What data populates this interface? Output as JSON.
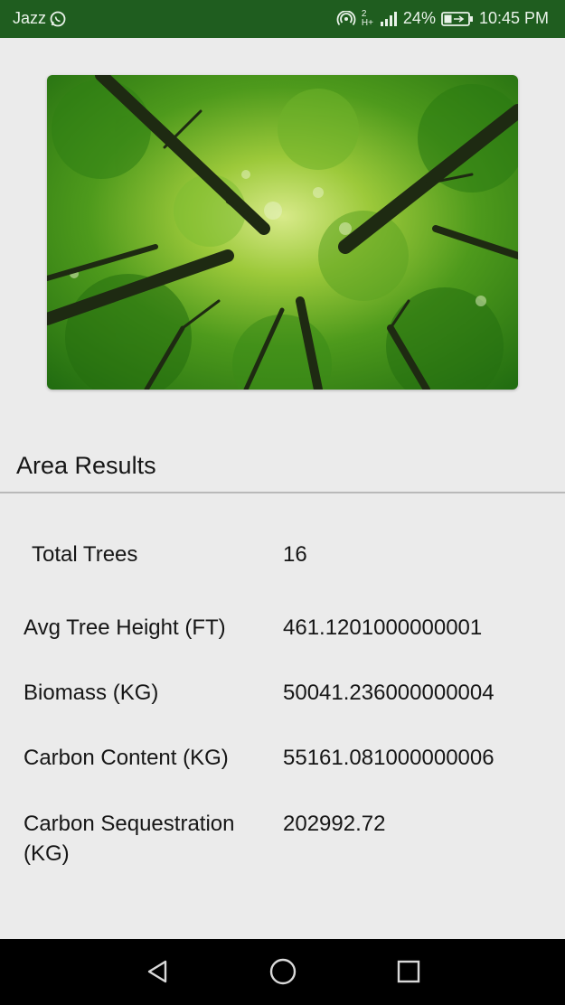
{
  "status_bar": {
    "carrier": "Jazz",
    "network_type": "2 H+",
    "battery": "24%",
    "time": "10:45 PM",
    "icons": [
      "whatsapp-icon",
      "hotspot-icon",
      "signal-icon",
      "battery-charging-icon"
    ]
  },
  "hero": {
    "image": "forest-canopy-photo"
  },
  "section": {
    "title": "Area Results"
  },
  "results": [
    {
      "label": "Total Trees",
      "value": "16"
    },
    {
      "label": "Avg Tree Height (FT)",
      "value": "461.1201000000001"
    },
    {
      "label": "Biomass (KG)",
      "value": "50041.236000000004"
    },
    {
      "label": "Carbon Content (KG)",
      "value": "55161.081000000006"
    },
    {
      "label": "Carbon Sequestration (KG)",
      "value": "202992.72"
    }
  ],
  "nav": {
    "icons": [
      "back-icon",
      "home-icon",
      "recents-icon"
    ]
  },
  "colors": {
    "status_bar": "#1f5d1f",
    "background": "#ebebeb",
    "nav_bar": "#000000"
  }
}
